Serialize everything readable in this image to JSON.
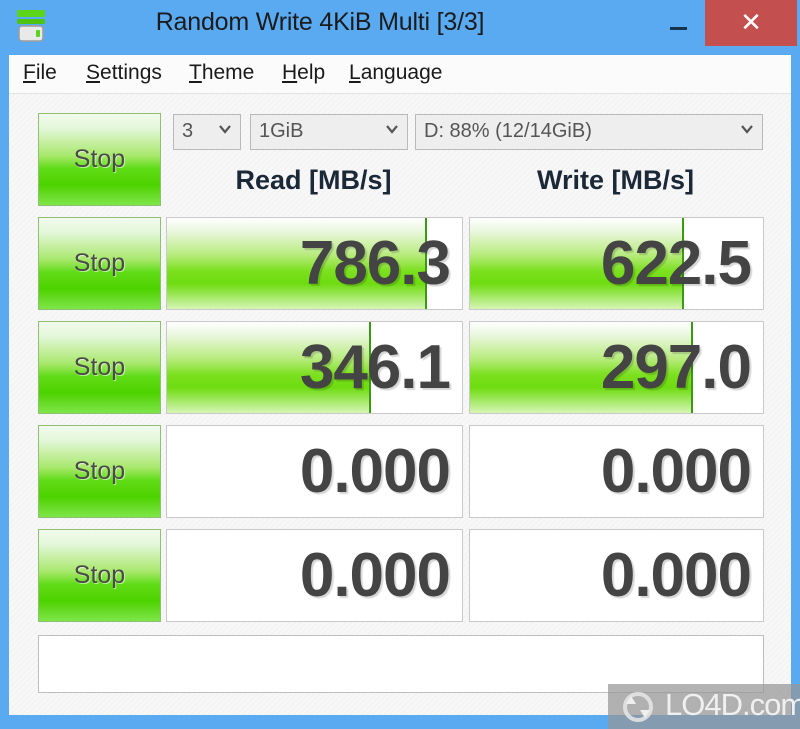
{
  "window": {
    "title": "Random Write 4KiB Multi [3/3]",
    "icon": "disk-drive-icon",
    "accent_color": "#5aaaf2",
    "close_color": "#c44f4f",
    "controls": {
      "minimize": "—",
      "maximize": "☐",
      "close": "✕"
    }
  },
  "menubar": {
    "items": [
      {
        "acc": "F",
        "rest": "ile"
      },
      {
        "acc": "S",
        "rest": "ettings"
      },
      {
        "acc": "T",
        "rest": "heme"
      },
      {
        "acc": "H",
        "rest": "elp"
      },
      {
        "acc": "L",
        "rest": "anguage"
      }
    ]
  },
  "toolbar": {
    "stop_label": "Stop",
    "test_count": "3",
    "test_size": "1GiB",
    "target_drive": "D: 88% (12/14GiB)",
    "chevron_icon": "chevron-down-icon"
  },
  "headers": {
    "read": "Read [MB/s]",
    "write": "Write [MB/s]"
  },
  "rows": [
    {
      "stop_label": "Stop",
      "read_value": "786.3",
      "read_fill_pct": 88,
      "write_value": "622.5",
      "write_fill_pct": 73
    },
    {
      "stop_label": "Stop",
      "read_value": "346.1",
      "read_fill_pct": 69,
      "write_value": "297.0",
      "write_fill_pct": 76
    },
    {
      "stop_label": "Stop",
      "read_value": "0.000",
      "read_fill_pct": 0,
      "write_value": "0.000",
      "write_fill_pct": 0
    },
    {
      "stop_label": "Stop",
      "read_value": "0.000",
      "read_fill_pct": 0,
      "write_value": "0.000",
      "write_fill_pct": 0
    }
  ],
  "comment": {
    "value": "",
    "placeholder": ""
  },
  "watermark": {
    "text": "LO4D.com",
    "icon": "circular-arrows-icon"
  }
}
